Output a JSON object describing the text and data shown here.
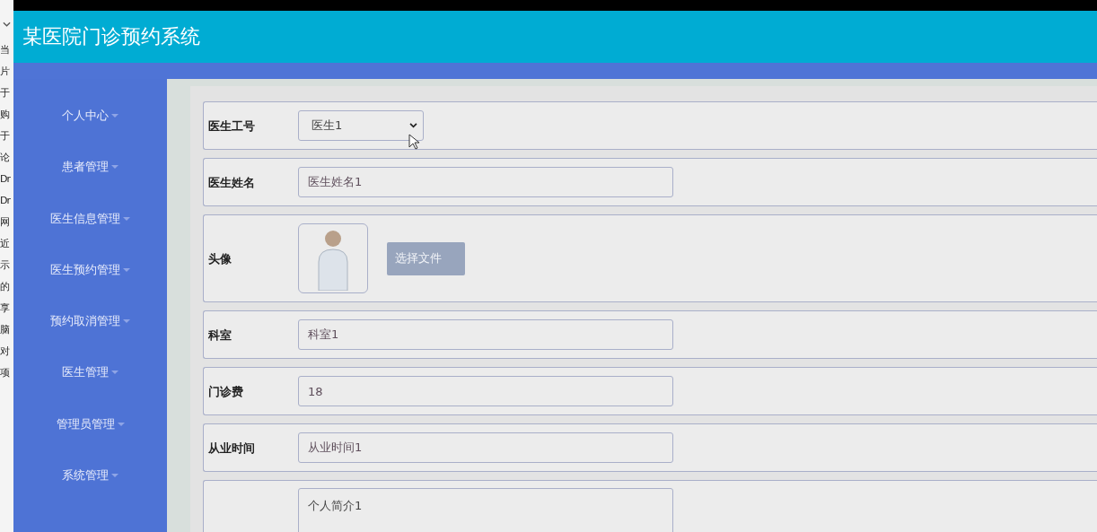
{
  "background_window": {
    "fragments": [
      "当",
      "片",
      "于",
      "购",
      "于",
      "论",
      "Dr",
      "Dr",
      "网",
      "近",
      "示",
      "的",
      "享",
      "脑",
      "对",
      "项"
    ]
  },
  "header": {
    "title": "某医院门诊预约系统"
  },
  "sidebar": {
    "items": [
      {
        "label": "个人中心"
      },
      {
        "label": "患者管理"
      },
      {
        "label": "医生信息管理"
      },
      {
        "label": "医生预约管理"
      },
      {
        "label": "预约取消管理"
      },
      {
        "label": "医生管理"
      },
      {
        "label": "管理员管理"
      },
      {
        "label": "系统管理"
      }
    ]
  },
  "form": {
    "fields": [
      {
        "kind": "select",
        "label": "医生工号",
        "value": "医生1"
      },
      {
        "kind": "text",
        "label": "医生姓名",
        "value": "医生姓名1"
      },
      {
        "kind": "image",
        "label": "头像",
        "button": "选择文件"
      },
      {
        "kind": "text",
        "label": "科室",
        "value": "科室1"
      },
      {
        "kind": "text",
        "label": "门诊费",
        "value": "18"
      },
      {
        "kind": "text",
        "label": "从业时间",
        "value": "从业时间1"
      },
      {
        "kind": "textarea",
        "value": "个人简介1"
      }
    ]
  }
}
